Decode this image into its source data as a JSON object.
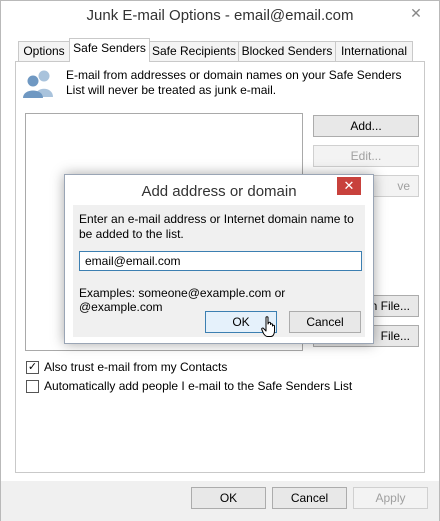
{
  "window": {
    "title": "Junk E-mail Options - email@email.com",
    "close_glyph": "✕"
  },
  "tabs": [
    {
      "label": "Options"
    },
    {
      "label": "Safe Senders"
    },
    {
      "label": "Safe Recipients"
    },
    {
      "label": "Blocked Senders"
    },
    {
      "label": "International"
    }
  ],
  "safe_senders": {
    "description": "E-mail from addresses or domain names on your Safe Senders List will never be treated as junk e-mail.",
    "buttons": {
      "add": "Add...",
      "edit": "Edit...",
      "remove_partial": "ve",
      "import_partial": "n File...",
      "export_partial": "File..."
    },
    "checkbox_trust_contacts": "Also trust e-mail from my Contacts",
    "checkbox_trust_contacts_checked": true,
    "check_glyph": "✓",
    "checkbox_auto_add": "Automatically add people I e-mail to the Safe Senders List",
    "checkbox_auto_add_checked": false
  },
  "footer": {
    "ok": "OK",
    "cancel": "Cancel",
    "apply": "Apply"
  },
  "dialog": {
    "title": "Add address or domain",
    "close_glyph": "✕",
    "prompt": "Enter an e-mail address or Internet domain name to be added to the list.",
    "input_value": "email@email.com",
    "examples": "Examples: someone@example.com or @example.com",
    "ok": "OK",
    "cancel": "Cancel"
  },
  "colors": {
    "dialog_close": "#c8413c",
    "focus_border": "#3c7fb1",
    "people_icon": "#a9c3dc"
  }
}
